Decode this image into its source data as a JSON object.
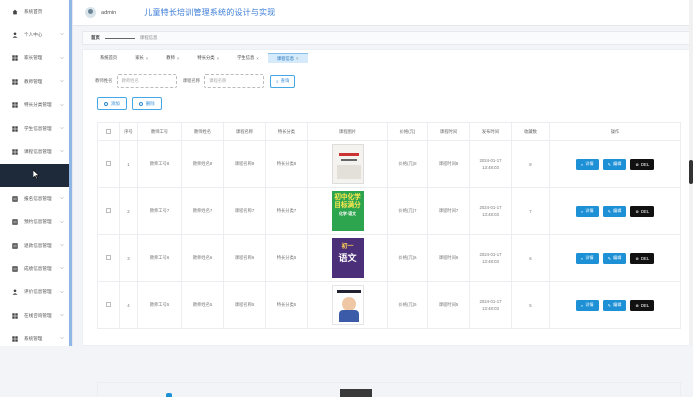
{
  "sidebar": {
    "items": [
      {
        "label": "系统首页",
        "icon": "home-icon",
        "chevron": false
      },
      {
        "label": "个人中心",
        "icon": "person-icon",
        "chevron": true
      },
      {
        "label": "家长管理",
        "icon": "grid-icon",
        "chevron": true
      },
      {
        "label": "教师管理",
        "icon": "grid-icon",
        "chevron": true
      },
      {
        "label": "特长分类管理",
        "icon": "grid-icon",
        "chevron": true
      },
      {
        "label": "学生信息管理",
        "icon": "grid-icon",
        "chevron": true
      },
      {
        "label": "课程信息管理",
        "icon": "grid-icon",
        "chevron": true
      },
      {
        "label": "",
        "icon": "",
        "chevron": false,
        "hover": true
      },
      {
        "label": "报名信息管理",
        "icon": "list-icon",
        "chevron": true
      },
      {
        "label": "预约信息管理",
        "icon": "list-icon",
        "chevron": true
      },
      {
        "label": "退款信息管理",
        "icon": "list-icon",
        "chevron": true
      },
      {
        "label": "成绩信息管理",
        "icon": "list-icon",
        "chevron": true
      },
      {
        "label": "评价信息管理",
        "icon": "person-icon",
        "chevron": true
      },
      {
        "label": "在线咨询管理",
        "icon": "grid-icon",
        "chevron": true
      },
      {
        "label": "系统管理",
        "icon": "grid-icon",
        "chevron": true
      }
    ]
  },
  "header": {
    "username": "admin",
    "system_title": "儿童特长培训管理系统的设计与实现"
  },
  "breadcrumb": {
    "home": "首页",
    "current": "课程信息"
  },
  "tabs": [
    {
      "label": "系统首页",
      "closable": false,
      "active": false
    },
    {
      "label": "家长",
      "closable": true,
      "active": false
    },
    {
      "label": "教师",
      "closable": true,
      "active": false
    },
    {
      "label": "特长分类",
      "closable": true,
      "active": false
    },
    {
      "label": "学生信息",
      "closable": true,
      "active": false
    },
    {
      "label": "课程信息",
      "closable": true,
      "active": true
    }
  ],
  "search": {
    "field1_label": "教师姓名",
    "field1_placeholder": "教师姓名",
    "field2_label": "课程名称",
    "field2_placeholder": "课程名称",
    "query_label": "查询"
  },
  "actions": {
    "add_label": "添加",
    "delete_label": "删除"
  },
  "table": {
    "headers": [
      "序号",
      "教师工号",
      "教师姓名",
      "课程名称",
      "特长分类",
      "课程图片",
      "价格(元)",
      "课程时间",
      "发布时间",
      "收藏数",
      "操作"
    ],
    "rows": [
      {
        "index": "1",
        "teacher_no": "教师工号8",
        "teacher_name": "教师姓名8",
        "course_name": "课程名称8",
        "category": "特长分类8",
        "image": "img1",
        "price": "价格(元)8",
        "course_time": "课程时间8",
        "publish_time": "2024-01-17 13:48:03",
        "favorites": "8"
      },
      {
        "index": "2",
        "teacher_no": "教师工号7",
        "teacher_name": "教师姓名7",
        "course_name": "课程名称7",
        "category": "特长分类7",
        "image": "img2",
        "price": "价格(元)7",
        "course_time": "课程时间7",
        "publish_time": "2024-01-17 13:48:03",
        "favorites": "7"
      },
      {
        "index": "3",
        "teacher_no": "教师工号6",
        "teacher_name": "教师姓名6",
        "course_name": "课程名称6",
        "category": "特长分类6",
        "image": "img3",
        "price": "价格(元)6",
        "course_time": "课程时间6",
        "publish_time": "2024-01-17 13:48:03",
        "favorites": "6"
      },
      {
        "index": "4",
        "teacher_no": "教师工号5",
        "teacher_name": "教师姓名5",
        "course_name": "课程名称5",
        "category": "特长分类5",
        "image": "img4",
        "price": "价格(元)5",
        "course_time": "课程时间5",
        "publish_time": "2024-01-17 13:48:03",
        "favorites": "5"
      }
    ],
    "img2_text": [
      "初中化学",
      "目标满分"
    ],
    "img2_sub": "化学·语文",
    "img3_text": [
      "初一",
      "语文"
    ],
    "detail_label": "详情",
    "edit_label": "编辑",
    "del_label": "DEL"
  }
}
